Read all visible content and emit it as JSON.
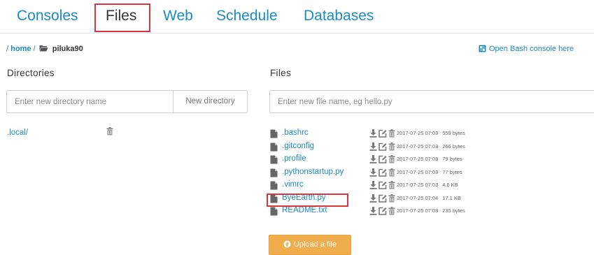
{
  "nav": {
    "tabs": [
      {
        "label": "Consoles"
      },
      {
        "label": "Files"
      },
      {
        "label": "Web"
      },
      {
        "label": "Schedule"
      },
      {
        "label": "Databases"
      }
    ],
    "active_tab": "Files"
  },
  "breadcrumb": {
    "root_sep": "/",
    "home": "home",
    "sep": "/",
    "current": "piluka90"
  },
  "bash_link": "Open Bash console here",
  "directories": {
    "heading": "Directories",
    "input_placeholder": "Enter new directory name",
    "button_label": "New directory",
    "items": [
      ".local/"
    ]
  },
  "files": {
    "heading": "Files",
    "input_placeholder": "Enter new file name, eg hello.py",
    "items": [
      {
        "name": ".bashrc",
        "modified": "2017-07-25 07:03",
        "size": "559 bytes"
      },
      {
        "name": ".gitconfig",
        "modified": "2017-07-25 07:03",
        "size": "266 bytes"
      },
      {
        "name": ".profile",
        "modified": "2017-07-25 07:03",
        "size": "79 bytes"
      },
      {
        "name": ".pythonstartup.py",
        "modified": "2017-07-25 07:03",
        "size": "77 bytes"
      },
      {
        "name": ".vimrc",
        "modified": "2017-07-25 07:03",
        "size": "4.6 KB"
      },
      {
        "name": "ByeEarth.py",
        "modified": "2017-07-25 07:04",
        "size": "17.1 KB"
      },
      {
        "name": "README.txt",
        "modified": "2017-07-25 07:03",
        "size": "235 bytes"
      }
    ],
    "upload_label": "Upload a file"
  },
  "colors": {
    "link": "#1a8cc4",
    "highlight": "#d9373f",
    "upload": "#f0ad4e"
  }
}
